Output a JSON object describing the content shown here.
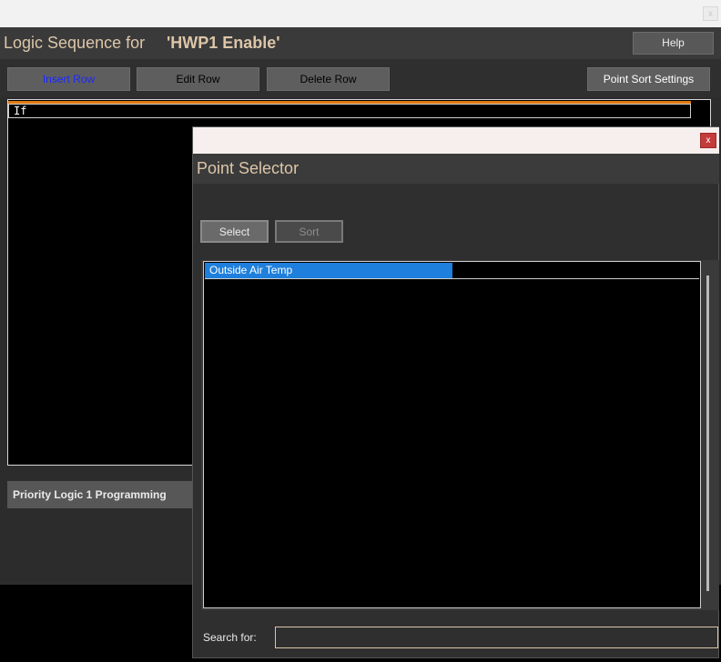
{
  "main_window": {
    "close_label": "x",
    "title_prefix": "Logic Sequence for",
    "title_name": "'HWP1 Enable'",
    "help_label": "Help",
    "toolbar": {
      "insert_row": "Insert Row",
      "edit_row": "Edit Row",
      "delete_row": "Delete Row",
      "point_sort_settings": "Point Sort Settings"
    },
    "logic_rows": [
      "If"
    ],
    "priority_label": "Priority Logic 1 Programming"
  },
  "point_selector": {
    "close_label": "x",
    "title": "Point Selector",
    "select_label": "Select",
    "sort_label": "Sort",
    "points": [
      "Outside Air Temp"
    ],
    "search_label": "Search for:",
    "search_value": ""
  },
  "colors": {
    "accent_tan": "#dcc6a8",
    "selection_blue": "#1e7fdc",
    "orange_accent": "#e07a12",
    "insert_row_text": "#1a28ff",
    "close_red": "#c43b3b"
  }
}
